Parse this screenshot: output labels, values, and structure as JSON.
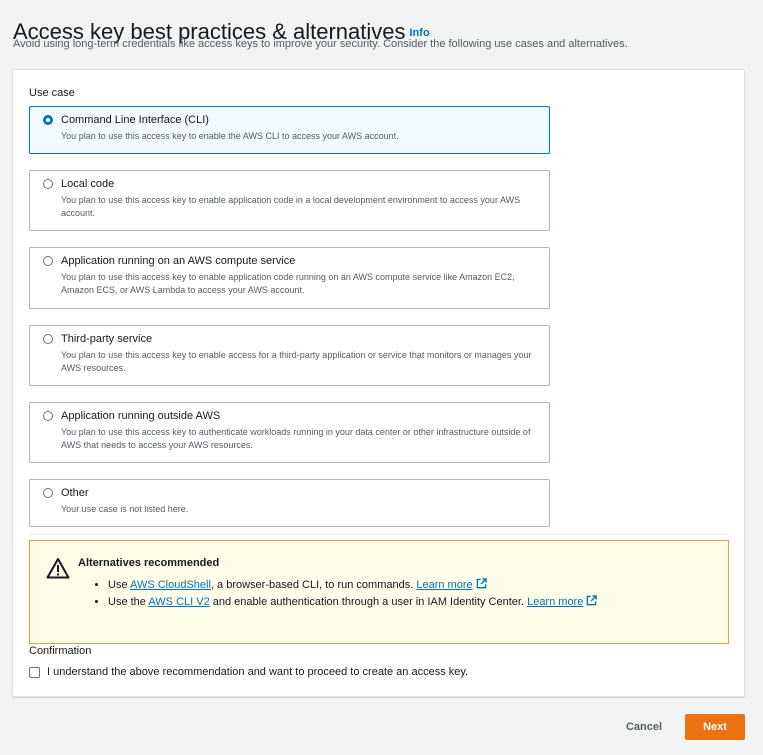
{
  "page": {
    "title": "Access key best practices & alternatives",
    "info_label": "Info",
    "description": "Avoid using long-term credentials like access keys to improve your security. Consider the following use cases and alternatives."
  },
  "use_case": {
    "label": "Use case",
    "selected_index": 0,
    "options": [
      {
        "title": "Command Line Interface (CLI)",
        "description": "You plan to use this access key to enable the AWS CLI to access your AWS account."
      },
      {
        "title": "Local code",
        "description": "You plan to use this access key to enable application code in a local development environment to access your AWS account."
      },
      {
        "title": "Application running on an AWS compute service",
        "description": "You plan to use this access key to enable application code running on an AWS compute service like Amazon EC2, Amazon ECS, or AWS Lambda to access your AWS account."
      },
      {
        "title": "Third-party service",
        "description": "You plan to use this access key to enable access for a third-party application or service that monitors or manages your AWS resources."
      },
      {
        "title": "Application running outside AWS",
        "description": "You plan to use this access key to authenticate workloads running in your data center or other infrastructure outside of AWS that needs to access your AWS resources."
      },
      {
        "title": "Other",
        "description": "Your use case is not listed here."
      }
    ]
  },
  "alert": {
    "title": "Alternatives recommended",
    "item1": {
      "prefix": "Use ",
      "link": "AWS CloudShell",
      "suffix": ", a browser-based CLI, to run commands. ",
      "learn_more": "Learn more"
    },
    "item2": {
      "prefix": "Use the ",
      "link": "AWS CLI V2",
      "suffix": " and enable authentication through a user in IAM Identity Center. ",
      "learn_more": "Learn more"
    },
    "icon": "warning-icon",
    "accent_color": "#d5a43a"
  },
  "confirmation": {
    "label": "Confirmation",
    "checkbox_text": "I understand the above recommendation and want to proceed to create an access key.",
    "checked": false
  },
  "footer": {
    "cancel_label": "Cancel",
    "next_label": "Next",
    "primary_color": "#ec7211"
  }
}
